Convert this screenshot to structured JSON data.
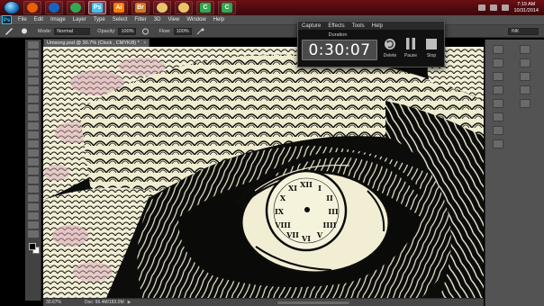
{
  "taskbar": {
    "apps": [
      {
        "name": "firefox",
        "glyph": "",
        "color": "#e66000"
      },
      {
        "name": "messenger",
        "glyph": "",
        "color": "#1565c0"
      },
      {
        "name": "chrome",
        "glyph": "",
        "color": "#34a853"
      },
      {
        "name": "photoshop",
        "glyph": "Ps",
        "color": "#3ec3f5"
      },
      {
        "name": "illustrator",
        "glyph": "Ai",
        "color": "#ff7c00"
      },
      {
        "name": "bridge",
        "glyph": "Br",
        "color": "#cc7a1b"
      },
      {
        "name": "folder",
        "glyph": "",
        "color": "#e9c46a"
      },
      {
        "name": "folder-2",
        "glyph": "",
        "color": "#e9c46a"
      },
      {
        "name": "camtasia-green",
        "glyph": "C",
        "color": "#2fa84f"
      },
      {
        "name": "camtasia-recorder",
        "glyph": "C",
        "color": "#2fa84f"
      }
    ],
    "clock_time": "7:19 AM",
    "clock_date": "10/31/2014"
  },
  "menubar": {
    "logo": "Ps",
    "items": [
      "File",
      "Edit",
      "Image",
      "Layer",
      "Type",
      "Select",
      "Filter",
      "3D",
      "View",
      "Window",
      "Help"
    ]
  },
  "options_bar": {
    "mode_label": "Mode:",
    "mode_value": "Normal",
    "opacity_label": "Opacity:",
    "opacity_value": "100%",
    "flow_label": "Flow:",
    "flow_value": "100%",
    "workspace": "INK"
  },
  "document": {
    "tab_title": "Umsong.psd @ 30.7% (Clock , CMYK/8) *",
    "tab_close": "×",
    "zoom": "30.67%",
    "doc_size": "Doc: 96.4M/183.0M",
    "status_arrow": "▶"
  },
  "recorder": {
    "menu": [
      "Capture",
      "Effects",
      "Tools",
      "Help"
    ],
    "duration_label": "Duration",
    "timer": "0:30:07",
    "delete_label": "Delete",
    "pause_label": "Pause",
    "stop_label": "Stop"
  },
  "clock_face": {
    "numerals": [
      "XII",
      "I",
      "II",
      "III",
      "IIII",
      "V",
      "VI",
      "VII",
      "VIII",
      "IX",
      "X",
      "XI"
    ]
  },
  "colors": {
    "taskbar": "#4d0a0e",
    "ps_ui": "#535353",
    "canvas_ink": "#0c0c0a",
    "canvas_paper": "#f4f1d7",
    "canvas_pink": "#d9a8b6"
  }
}
